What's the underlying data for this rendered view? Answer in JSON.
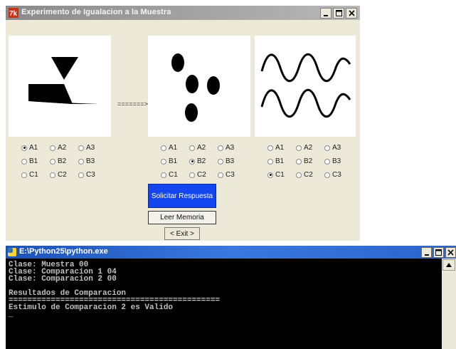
{
  "dialog": {
    "title": "Experimento de Igualacion a la Muestra",
    "arrow": "=======>",
    "radio_groups": [
      {
        "rows": [
          [
            "A1",
            "A2",
            "A3"
          ],
          [
            "B1",
            "B2",
            "B3"
          ],
          [
            "C1",
            "C2",
            "C3"
          ]
        ],
        "selected": "A1"
      },
      {
        "rows": [
          [
            "A1",
            "A2",
            "A3"
          ],
          [
            "B1",
            "B2",
            "B3"
          ],
          [
            "C1",
            "C2",
            "C3"
          ]
        ],
        "selected": "B2"
      },
      {
        "rows": [
          [
            "A1",
            "A2",
            "A3"
          ],
          [
            "B1",
            "B2",
            "B3"
          ],
          [
            "C1",
            "C2",
            "C3"
          ]
        ],
        "selected": "C1"
      }
    ],
    "buttons": {
      "solicitar": "Solicitar Respuesta",
      "leer": "Leer Memoria",
      "exit": "< Exit >"
    },
    "colors": {
      "solicitar_bg": "#1446f0"
    }
  },
  "console": {
    "title": "E:\\Python25\\python.exe",
    "lines": [
      "Clase: Muestra 00",
      "Clase: Comparacion 1 04",
      "Clase: Comparacion 2 00",
      "",
      "Resultados de Comparacion",
      "=============================================",
      "Estimulo de Comparacion 2 es Valido",
      "_"
    ]
  }
}
